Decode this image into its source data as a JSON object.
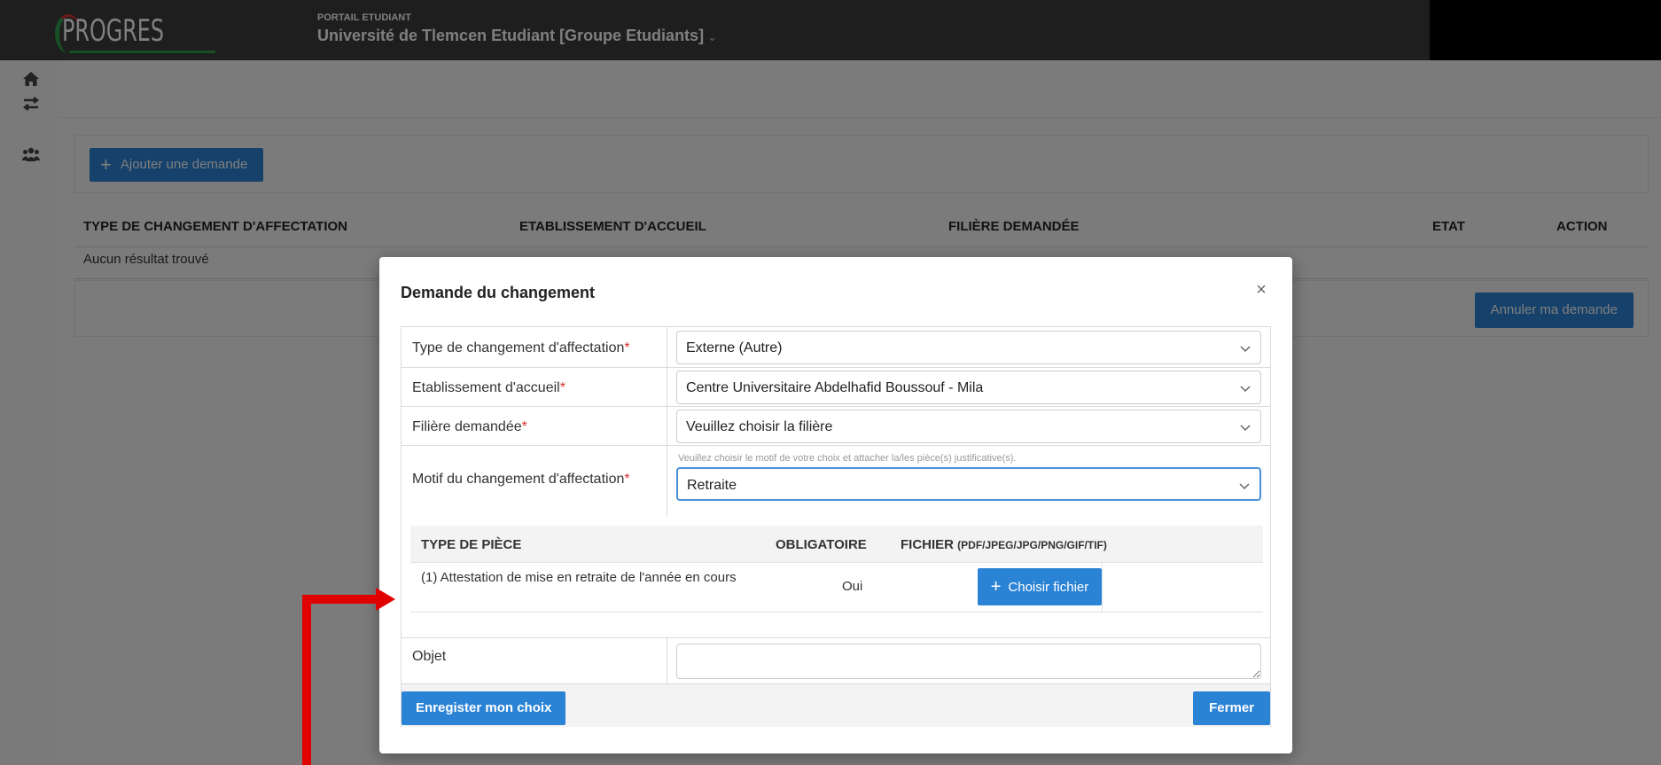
{
  "topbar": {
    "logo": "PROGRES",
    "portal_label": "PORTAIL ETUDIANT",
    "university": "Université de Tlemcen Etudiant [Groupe Etudiants]",
    "university_chevron": "⌄"
  },
  "sidebar": {
    "items": [
      {
        "icon": "home-icon"
      },
      {
        "icon": "transfer-icon"
      },
      {
        "icon": "group-icon"
      }
    ]
  },
  "page": {
    "add_button": "Ajouter une demande",
    "columns": [
      "TYPE DE CHANGEMENT D'AFFECTATION",
      "ETABLISSEMENT D'ACCUEIL",
      "FILIÈRE DEMANDÉE",
      "ETAT",
      "ACTION"
    ],
    "no_result": "Aucun résultat trouvé",
    "cancel_button": "Annuler ma demande"
  },
  "modal": {
    "title": "Demande du changement",
    "close": "×",
    "fields": {
      "type_label": "Type de changement d'affectation",
      "type_value": "Externe (Autre)",
      "etab_label": "Etablissement d'accueil",
      "etab_value": "Centre Universitaire Abdelhafid Boussouf - Mila",
      "filiere_label": "Filière demandée",
      "filiere_value": "Veuillez choisir la filière",
      "motif_label": "Motif du changement d'affectation",
      "motif_hint": "Veuillez choisir le motif de votre choix et attacher la/les pièce(s) justificative(s).",
      "motif_value": "Retraite",
      "required_mark": "*",
      "objet_label": "Objet",
      "objet_value": ""
    },
    "pieces": {
      "col_type": "TYPE DE PIÈCE",
      "col_oblig": "OBLIGATOIRE",
      "col_file": "FICHIER",
      "col_file_formats": "(PDF/JPEG/JPG/PNG/GIF/TIF)",
      "rows": [
        {
          "type": "(1) Attestation de mise en retraite de l'année en cours",
          "obligatoire": "Oui",
          "button": "Choisir fichier"
        }
      ]
    },
    "save_button": "Enregister mon choix",
    "close_button": "Fermer"
  },
  "colors": {
    "primary": "#2b83d6",
    "topbar": "#3d3d3d",
    "required": "#d32f2f",
    "annotation": "#e00000"
  }
}
